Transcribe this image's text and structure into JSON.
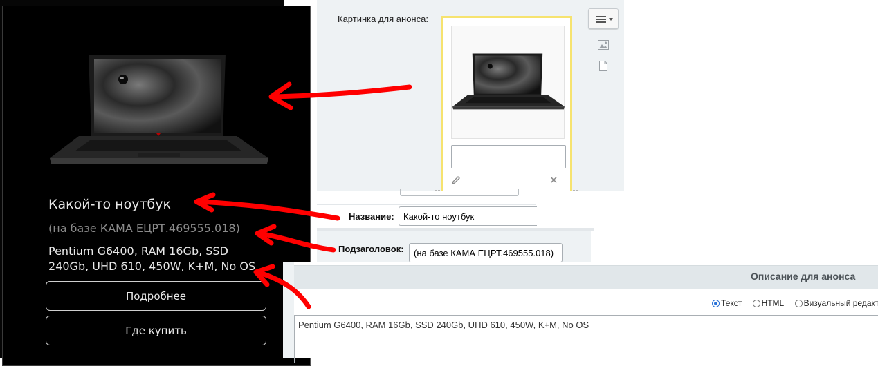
{
  "product_card": {
    "title": "Какой-то ноутбук",
    "subtitle": "(на базе КАМА ЕЦРТ.469555.018)",
    "description": "Pentium G6400, RAM 16Gb, SSD 240Gb, UHD 610, 450W, K+M, No OS",
    "more_button": "Подробнее",
    "buy_button": "Где купить"
  },
  "admin": {
    "announce_image": {
      "label": "Картинка для анонса:",
      "description_value": ""
    },
    "name_field": {
      "label": "Название:",
      "value": "Какой-то ноутбук"
    },
    "subtitle_field": {
      "label": "Подзаголовок:",
      "value": "(на базе КАМА ЕЦРТ.469555.018)"
    },
    "announce_description": {
      "title": "Описание для анонса",
      "modes": [
        {
          "label": "Текст",
          "selected": true
        },
        {
          "label": "HTML",
          "selected": false
        },
        {
          "label": "Визуальный редакт",
          "selected": false
        }
      ],
      "text": "Pentium G6400, RAM 16Gb, SSD 240Gb, UHD 610, 450W, K+M, No OS"
    }
  },
  "colors": {
    "card_background": "#000000",
    "annotation_red": "#ff0000",
    "selected_radio": "#2b74d8",
    "image_highlight": "#f6e36f"
  }
}
